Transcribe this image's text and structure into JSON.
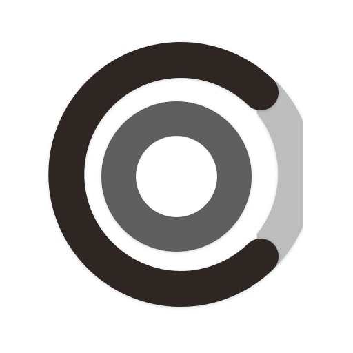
{
  "logo": {
    "colors": {
      "background": "#ffffff",
      "outer_arc_dark": "#2e2522",
      "outer_arc_light": "#bdbdbd",
      "inner_ring": "#5f5f5f",
      "center": "#ffffff"
    },
    "icon": "concentric-ring-logo"
  }
}
